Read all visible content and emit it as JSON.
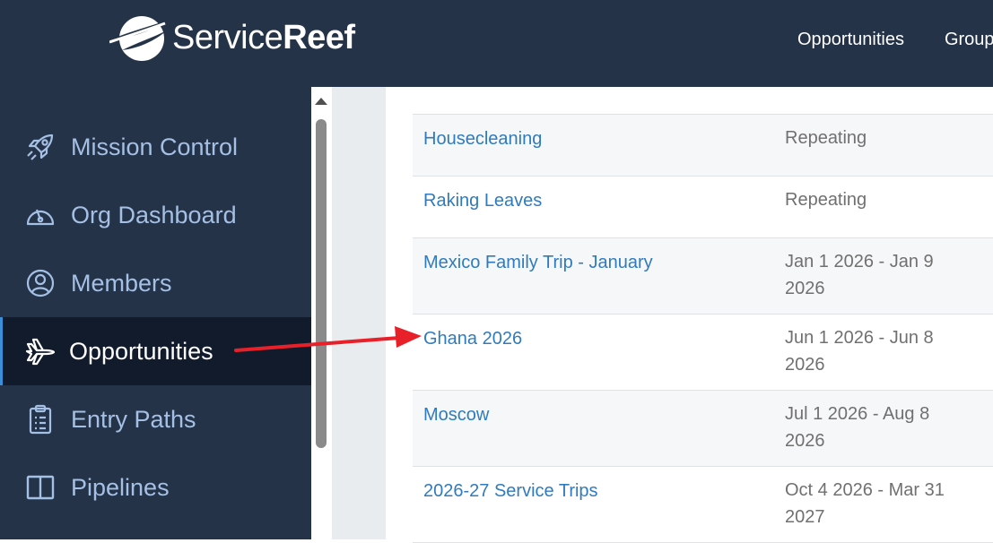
{
  "header": {
    "logo_text_light": "Service",
    "logo_text_bold": "Reef",
    "nav": [
      "Opportunities",
      "Groups"
    ]
  },
  "sidebar": {
    "items": [
      {
        "label": "Mission Control",
        "icon": "rocket-icon"
      },
      {
        "label": "Org Dashboard",
        "icon": "gauge-icon"
      },
      {
        "label": "Members",
        "icon": "user-circle-icon"
      },
      {
        "label": "Opportunities",
        "icon": "plane-icon",
        "active": true
      },
      {
        "label": "Entry Paths",
        "icon": "clipboard-icon"
      },
      {
        "label": "Pipelines",
        "icon": "columns-icon"
      }
    ]
  },
  "table": {
    "rows": [
      {
        "name": "Housecleaning",
        "date": "Repeating"
      },
      {
        "name": "Raking Leaves",
        "date": "Repeating"
      },
      {
        "name": "Mexico Family Trip - January",
        "date": "Jan 1 2026 - Jan 9 2026"
      },
      {
        "name": "Ghana 2026",
        "date": "Jun 1 2026 - Jun 8 2026"
      },
      {
        "name": "Moscow",
        "date": "Jul 1 2026 - Aug 8 2026"
      },
      {
        "name": "2026-27 Service Trips",
        "date": "Oct 4 2026 - Mar 31 2027"
      }
    ]
  },
  "colors": {
    "nav_bg": "#253349",
    "active_bg": "#111b2b",
    "link": "#2f7bbd",
    "sidebar_text": "#a4c0e4",
    "annotation_arrow": "#e8202a"
  }
}
